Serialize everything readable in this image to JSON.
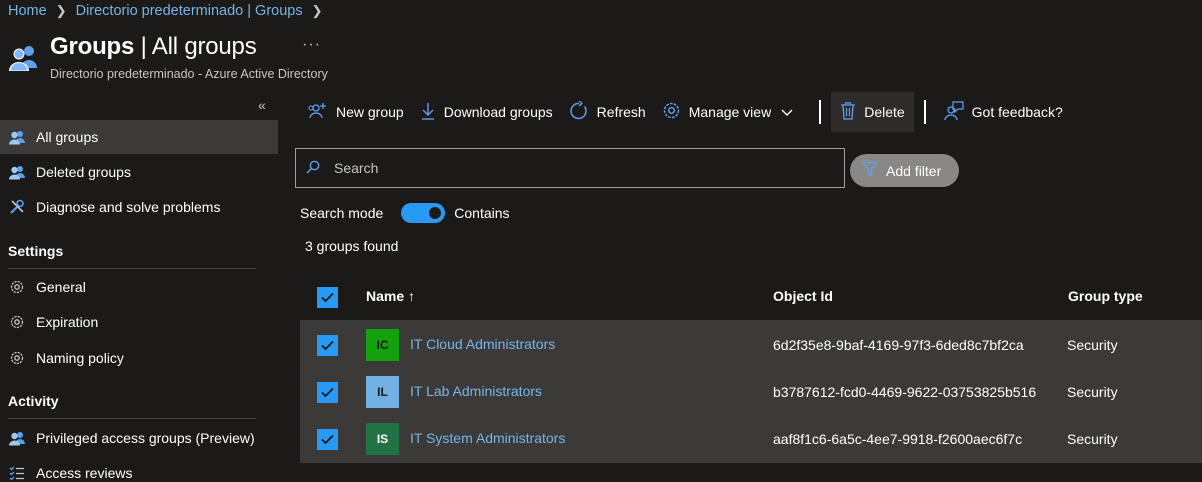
{
  "breadcrumb": {
    "items": [
      "Home",
      "Directorio predeterminado | Groups"
    ]
  },
  "header": {
    "title_bold": "Groups",
    "title_rest": " | All groups",
    "more": "···",
    "subtitle": "Directorio predeterminado - Azure Active Directory",
    "icon": "groups-icon"
  },
  "sidebar": {
    "collapse": "«",
    "items": [
      {
        "label": "All groups",
        "icon": "groups-icon"
      },
      {
        "label": "Deleted groups",
        "icon": "groups-icon"
      },
      {
        "label": "Diagnose and solve problems",
        "icon": "wrench-icon"
      }
    ],
    "settings_heading": "Settings",
    "settings_items": [
      {
        "label": "General",
        "icon": "gear-icon"
      },
      {
        "label": "Expiration",
        "icon": "gear-icon"
      },
      {
        "label": "Naming policy",
        "icon": "gear-icon"
      }
    ],
    "activity_heading": "Activity",
    "activity_items": [
      {
        "label": "Privileged access groups (Preview)",
        "icon": "groups-icon"
      },
      {
        "label": "Access reviews",
        "icon": "checklist-icon"
      }
    ]
  },
  "toolbar": {
    "new_group": "New group",
    "download_groups": "Download groups",
    "refresh": "Refresh",
    "manage_view": "Manage view",
    "delete": "Delete",
    "feedback": "Got feedback?"
  },
  "search": {
    "placeholder": "Search",
    "add_filter": "Add filter",
    "mode_label": "Search mode",
    "mode_value": "Contains",
    "mode_on": true,
    "result_count": "3 groups found"
  },
  "table": {
    "headers": {
      "name": "Name ↑",
      "object_id": "Object Id",
      "group_type": "Group type"
    },
    "rows": [
      {
        "initials": "IC",
        "name": "IT Cloud Administrators",
        "object_id": "6d2f35e8-9baf-4169-97f3-6ded8c7bf2ca",
        "group_type": "Security",
        "avatar_color": "#13a10e",
        "initials_color": "#1b1a19",
        "checked": true
      },
      {
        "initials": "IL",
        "name": "IT Lab Administrators",
        "object_id": "b3787612-fcd0-4469-9622-03753825b516",
        "group_type": "Security",
        "avatar_color": "#71afe5",
        "initials_color": "#1b1a19",
        "checked": true
      },
      {
        "initials": "IS",
        "name": "IT System Administrators",
        "object_id": "aaf8f1c6-6a5c-4ee7-9918-f2600aec6f7c",
        "group_type": "Security",
        "avatar_color": "#217346",
        "initials_color": "#ffffff",
        "checked": true
      }
    ]
  },
  "colors": {
    "background": "#1b1a19",
    "accent": "#2899f5",
    "link": "#75b6e7",
    "selected_row": "#3b3a39"
  }
}
